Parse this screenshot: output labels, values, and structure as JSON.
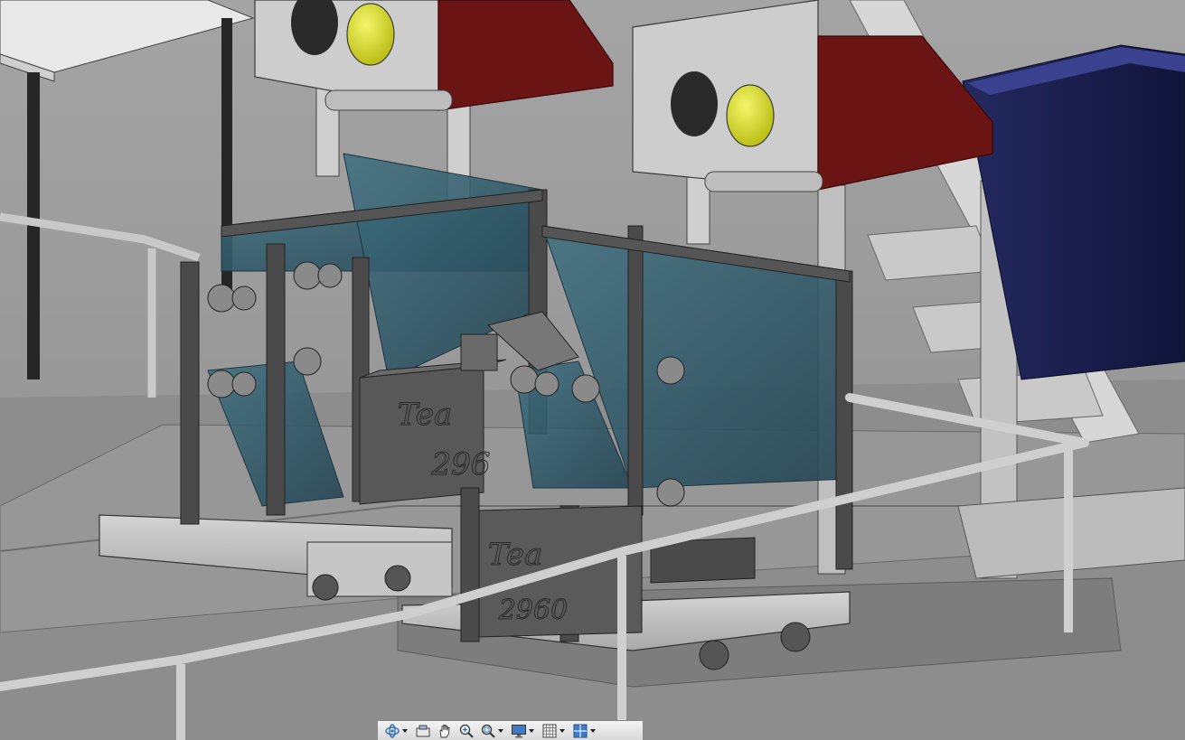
{
  "viewport": {
    "background": "#9a9a9a",
    "robots": [
      {
        "id": "robot-left",
        "team_label_top": "Tea",
        "team_label_bottom": "296"
      },
      {
        "id": "robot-right",
        "team_label_top": "Tea",
        "team_label_bottom": "2960"
      }
    ],
    "colors": {
      "dispenser_red": "#6b1414",
      "lens_yellow": "#d8dc1e",
      "bin_navy": "#1a1f4d",
      "hopper_glass": "#2f5a6a",
      "frame": "#4a4a4a",
      "chassis": "#bdbdbd",
      "floor": "#8c8c8c",
      "rail": "#c4c4c4"
    }
  },
  "toolbar": {
    "items": [
      {
        "icon": "orbit-icon",
        "has_dropdown": true
      },
      {
        "icon": "look-at-icon",
        "has_dropdown": false
      },
      {
        "icon": "pan-hand-icon",
        "has_dropdown": false
      },
      {
        "icon": "zoom-icon",
        "has_dropdown": false
      },
      {
        "icon": "zoom-window-icon",
        "has_dropdown": true
      },
      {
        "icon": "display-settings-icon",
        "has_dropdown": true
      },
      {
        "icon": "grid-icon",
        "has_dropdown": true
      },
      {
        "icon": "viewports-icon",
        "has_dropdown": true
      }
    ]
  }
}
